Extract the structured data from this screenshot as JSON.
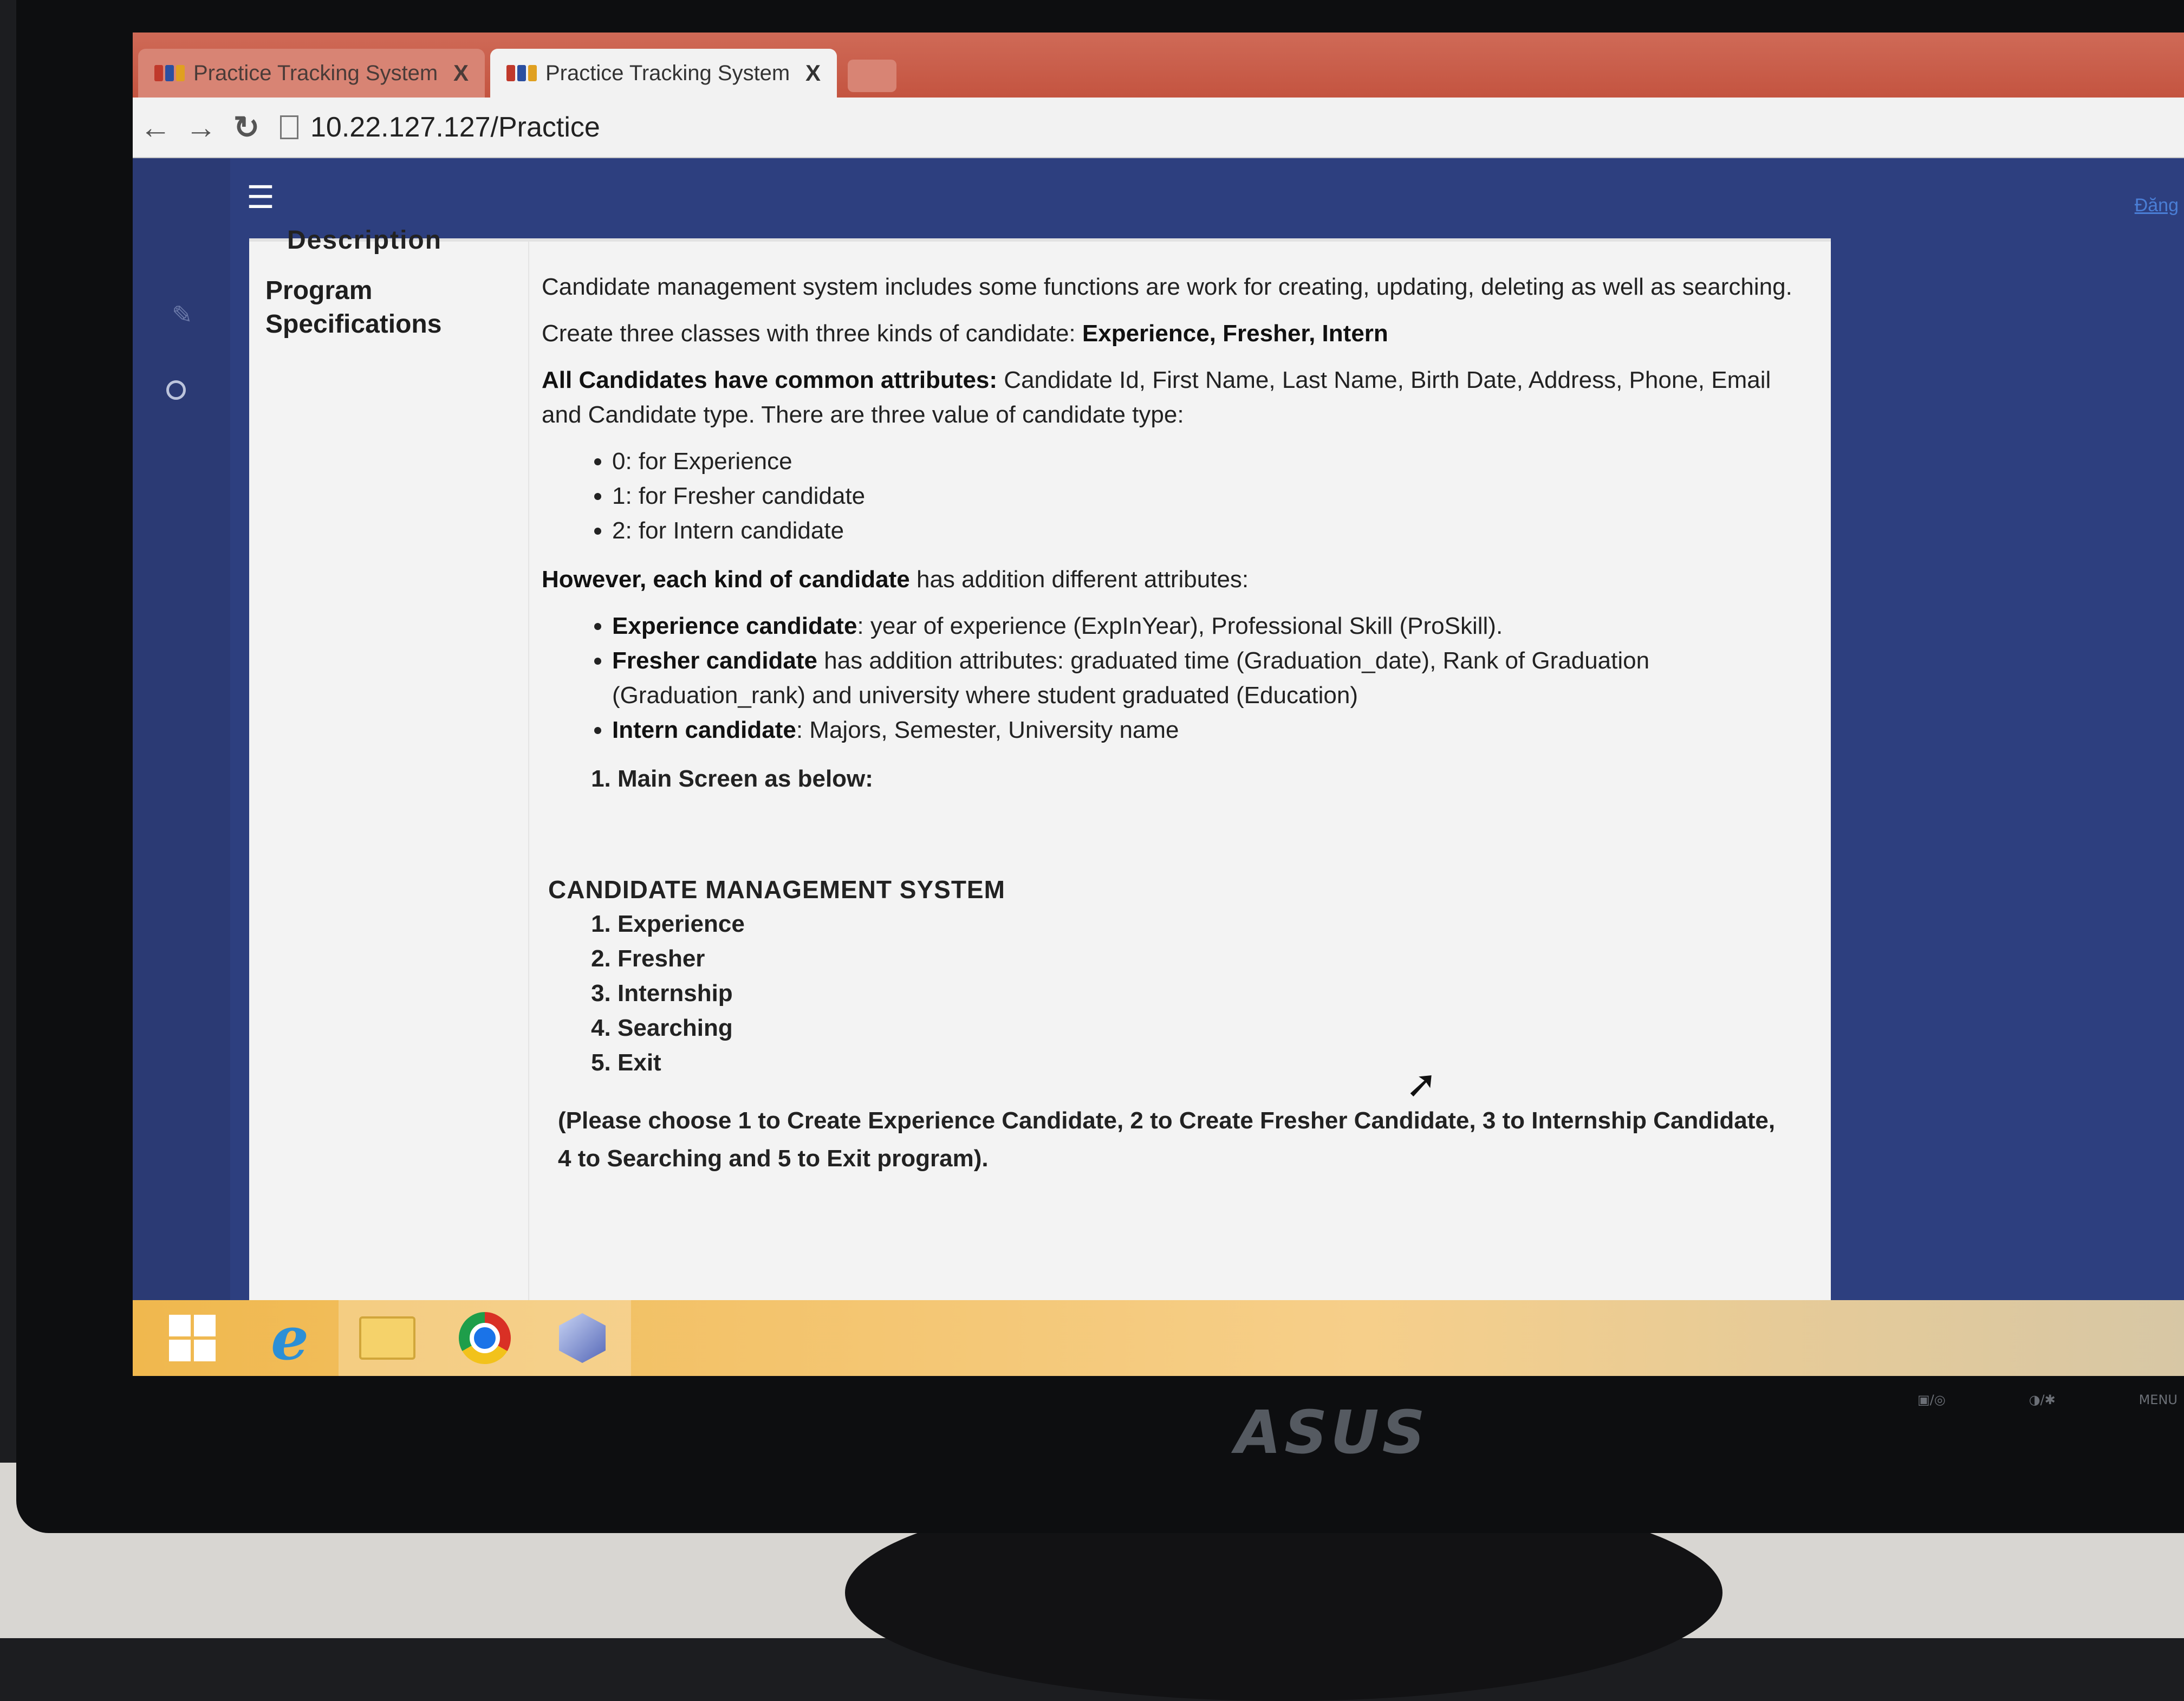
{
  "browser": {
    "tabs": [
      {
        "title": "Practice Tracking System",
        "active": false
      },
      {
        "title": "Practice Tracking System",
        "active": true
      }
    ],
    "tab_close_glyph": "X",
    "url": "10.22.127.127/Practice"
  },
  "app": {
    "user_link": "Đăng",
    "panel_heading": "Description",
    "section_label": "Program Specifications"
  },
  "content": {
    "intro": "Candidate management system includes some functions are work for creating, updating, deleting as well as searching.",
    "classes_prefix": "Create three classes with three kinds of candidate: ",
    "classes_list": "Experience, Fresher, Intern",
    "common_bold": "All Candidates have common attributes:",
    "common_rest": " Candidate Id, First Name, Last Name, Birth Date, Address, Phone, Email and Candidate type. There are three value of candidate type:",
    "types": [
      "0: for Experience",
      "1: for Fresher candidate",
      "2: for Intern candidate"
    ],
    "however_bold": "However, each kind of candidate",
    "however_rest": " has addition different attributes:",
    "kinds": [
      {
        "name": "Experience candidate",
        "desc": ": year of experience (ExpInYear), Professional Skill (ProSkill)."
      },
      {
        "name": "Fresher candidate",
        "desc": " has addition attributes: graduated time (Graduation_date), Rank of Graduation (Graduation_rank) and university where student graduated (Education)"
      },
      {
        "name": "Intern candidate",
        "desc": ": Majors, Semester, University name"
      }
    ],
    "main_screen": "Main Screen as below:",
    "system_title": "CANDIDATE MANAGEMENT SYSTEM",
    "menu": [
      "Experience",
      "Fresher",
      "Internship",
      "Searching",
      "Exit"
    ],
    "instruction": "(Please choose 1 to Create Experience Candidate, 2 to Create Fresher Candidate, 3 to Internship Candidate, 4 to Searching and 5 to Exit program)."
  },
  "taskbar": {
    "items": [
      "windows-start-icon",
      "internet-explorer-icon",
      "file-explorer-icon",
      "chrome-icon",
      "app-cube-icon"
    ]
  },
  "monitor": {
    "brand": "ASUS",
    "buttons": [
      "▣/◎",
      "◑/✱",
      "MENU"
    ]
  }
}
